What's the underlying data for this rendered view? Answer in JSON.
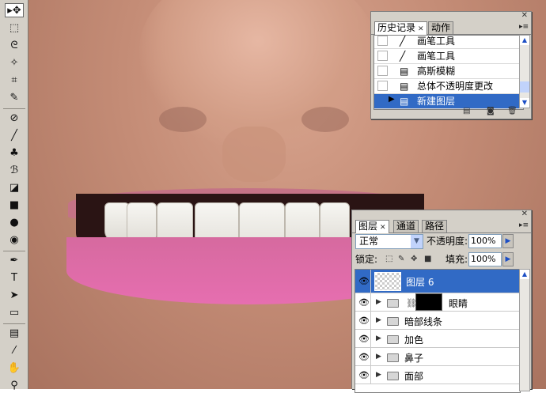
{
  "toolbox": {
    "tools": [
      {
        "name": "move-tool-icon",
        "glyph": "▸✥",
        "active": true
      },
      {
        "name": "marquee-tool-icon",
        "glyph": "⬚"
      },
      {
        "name": "lasso-tool-icon",
        "glyph": "ᘓ"
      },
      {
        "name": "magic-wand-tool-icon",
        "glyph": "✧"
      },
      {
        "name": "crop-tool-icon",
        "glyph": "⌗"
      },
      {
        "name": "slice-tool-icon",
        "glyph": "✎"
      },
      {
        "name": "healing-brush-tool-icon",
        "glyph": "⊘"
      },
      {
        "name": "brush-tool-icon",
        "glyph": "╱"
      },
      {
        "name": "clone-stamp-tool-icon",
        "glyph": "♣"
      },
      {
        "name": "history-brush-tool-icon",
        "glyph": "ℬ"
      },
      {
        "name": "eraser-tool-icon",
        "glyph": "◪"
      },
      {
        "name": "gradient-tool-icon",
        "glyph": "■"
      },
      {
        "name": "blur-tool-icon",
        "glyph": "●"
      },
      {
        "name": "dodge-tool-icon",
        "glyph": "◉"
      },
      {
        "name": "pen-tool-icon",
        "glyph": "✒"
      },
      {
        "name": "type-tool-icon",
        "glyph": "T"
      },
      {
        "name": "path-selection-tool-icon",
        "glyph": "➤"
      },
      {
        "name": "rectangle-tool-icon",
        "glyph": "▭"
      },
      {
        "name": "notes-tool-icon",
        "glyph": "▤"
      },
      {
        "name": "eyedropper-tool-icon",
        "glyph": "⁄"
      },
      {
        "name": "hand-tool-icon",
        "glyph": "✋"
      },
      {
        "name": "zoom-tool-icon",
        "glyph": "⚲"
      }
    ]
  },
  "history": {
    "tabs": [
      {
        "label": "历史记录",
        "active": true
      },
      {
        "label": "动作",
        "active": false
      }
    ],
    "items": [
      {
        "label": "画笔工具",
        "icon": "brush-icon",
        "glyph": "╱"
      },
      {
        "label": "画笔工具",
        "icon": "brush-icon",
        "glyph": "╱"
      },
      {
        "label": "高斯模糊",
        "icon": "document-icon",
        "glyph": "▤"
      },
      {
        "label": "总体不透明度更改",
        "icon": "document-icon",
        "glyph": "▤"
      },
      {
        "label": "新建图层",
        "icon": "document-icon",
        "glyph": "▤",
        "selected": true
      }
    ]
  },
  "layers": {
    "tabs": [
      {
        "label": "图层",
        "active": true
      },
      {
        "label": "通道",
        "active": false
      },
      {
        "label": "路径",
        "active": false
      }
    ],
    "blend_mode": "正常",
    "opacity_label": "不透明度:",
    "opacity_value": "100%",
    "lock_label": "锁定:",
    "fill_label": "填充:",
    "fill_value": "100%",
    "rows": [
      {
        "name": "图层 6",
        "type": "layer",
        "selected": true
      },
      {
        "name": "眼睛",
        "type": "group-mask"
      },
      {
        "name": "暗部线条",
        "type": "group"
      },
      {
        "name": "加色",
        "type": "group"
      },
      {
        "name": "鼻子",
        "type": "group"
      },
      {
        "name": "面部",
        "type": "group"
      }
    ]
  },
  "colors": {
    "selection": "#316ac5",
    "panel": "#d4d0c8",
    "lip": "#e66eb0"
  }
}
